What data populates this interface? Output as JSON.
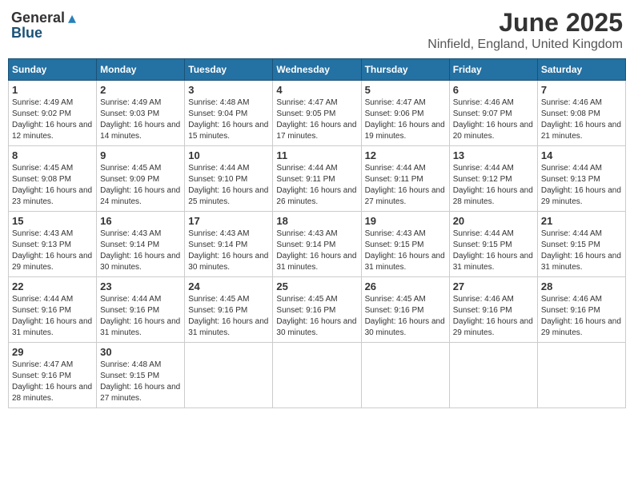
{
  "logo": {
    "general": "General",
    "blue": "Blue",
    "tagline": ""
  },
  "title": "June 2025",
  "location": "Ninfield, England, United Kingdom",
  "headers": [
    "Sunday",
    "Monday",
    "Tuesday",
    "Wednesday",
    "Thursday",
    "Friday",
    "Saturday"
  ],
  "weeks": [
    [
      {
        "day": "1",
        "sunrise": "Sunrise: 4:49 AM",
        "sunset": "Sunset: 9:02 PM",
        "daylight": "Daylight: 16 hours and 12 minutes."
      },
      {
        "day": "2",
        "sunrise": "Sunrise: 4:49 AM",
        "sunset": "Sunset: 9:03 PM",
        "daylight": "Daylight: 16 hours and 14 minutes."
      },
      {
        "day": "3",
        "sunrise": "Sunrise: 4:48 AM",
        "sunset": "Sunset: 9:04 PM",
        "daylight": "Daylight: 16 hours and 15 minutes."
      },
      {
        "day": "4",
        "sunrise": "Sunrise: 4:47 AM",
        "sunset": "Sunset: 9:05 PM",
        "daylight": "Daylight: 16 hours and 17 minutes."
      },
      {
        "day": "5",
        "sunrise": "Sunrise: 4:47 AM",
        "sunset": "Sunset: 9:06 PM",
        "daylight": "Daylight: 16 hours and 19 minutes."
      },
      {
        "day": "6",
        "sunrise": "Sunrise: 4:46 AM",
        "sunset": "Sunset: 9:07 PM",
        "daylight": "Daylight: 16 hours and 20 minutes."
      },
      {
        "day": "7",
        "sunrise": "Sunrise: 4:46 AM",
        "sunset": "Sunset: 9:08 PM",
        "daylight": "Daylight: 16 hours and 21 minutes."
      }
    ],
    [
      {
        "day": "8",
        "sunrise": "Sunrise: 4:45 AM",
        "sunset": "Sunset: 9:08 PM",
        "daylight": "Daylight: 16 hours and 23 minutes."
      },
      {
        "day": "9",
        "sunrise": "Sunrise: 4:45 AM",
        "sunset": "Sunset: 9:09 PM",
        "daylight": "Daylight: 16 hours and 24 minutes."
      },
      {
        "day": "10",
        "sunrise": "Sunrise: 4:44 AM",
        "sunset": "Sunset: 9:10 PM",
        "daylight": "Daylight: 16 hours and 25 minutes."
      },
      {
        "day": "11",
        "sunrise": "Sunrise: 4:44 AM",
        "sunset": "Sunset: 9:11 PM",
        "daylight": "Daylight: 16 hours and 26 minutes."
      },
      {
        "day": "12",
        "sunrise": "Sunrise: 4:44 AM",
        "sunset": "Sunset: 9:11 PM",
        "daylight": "Daylight: 16 hours and 27 minutes."
      },
      {
        "day": "13",
        "sunrise": "Sunrise: 4:44 AM",
        "sunset": "Sunset: 9:12 PM",
        "daylight": "Daylight: 16 hours and 28 minutes."
      },
      {
        "day": "14",
        "sunrise": "Sunrise: 4:44 AM",
        "sunset": "Sunset: 9:13 PM",
        "daylight": "Daylight: 16 hours and 29 minutes."
      }
    ],
    [
      {
        "day": "15",
        "sunrise": "Sunrise: 4:43 AM",
        "sunset": "Sunset: 9:13 PM",
        "daylight": "Daylight: 16 hours and 29 minutes."
      },
      {
        "day": "16",
        "sunrise": "Sunrise: 4:43 AM",
        "sunset": "Sunset: 9:14 PM",
        "daylight": "Daylight: 16 hours and 30 minutes."
      },
      {
        "day": "17",
        "sunrise": "Sunrise: 4:43 AM",
        "sunset": "Sunset: 9:14 PM",
        "daylight": "Daylight: 16 hours and 30 minutes."
      },
      {
        "day": "18",
        "sunrise": "Sunrise: 4:43 AM",
        "sunset": "Sunset: 9:14 PM",
        "daylight": "Daylight: 16 hours and 31 minutes."
      },
      {
        "day": "19",
        "sunrise": "Sunrise: 4:43 AM",
        "sunset": "Sunset: 9:15 PM",
        "daylight": "Daylight: 16 hours and 31 minutes."
      },
      {
        "day": "20",
        "sunrise": "Sunrise: 4:44 AM",
        "sunset": "Sunset: 9:15 PM",
        "daylight": "Daylight: 16 hours and 31 minutes."
      },
      {
        "day": "21",
        "sunrise": "Sunrise: 4:44 AM",
        "sunset": "Sunset: 9:15 PM",
        "daylight": "Daylight: 16 hours and 31 minutes."
      }
    ],
    [
      {
        "day": "22",
        "sunrise": "Sunrise: 4:44 AM",
        "sunset": "Sunset: 9:16 PM",
        "daylight": "Daylight: 16 hours and 31 minutes."
      },
      {
        "day": "23",
        "sunrise": "Sunrise: 4:44 AM",
        "sunset": "Sunset: 9:16 PM",
        "daylight": "Daylight: 16 hours and 31 minutes."
      },
      {
        "day": "24",
        "sunrise": "Sunrise: 4:45 AM",
        "sunset": "Sunset: 9:16 PM",
        "daylight": "Daylight: 16 hours and 31 minutes."
      },
      {
        "day": "25",
        "sunrise": "Sunrise: 4:45 AM",
        "sunset": "Sunset: 9:16 PM",
        "daylight": "Daylight: 16 hours and 30 minutes."
      },
      {
        "day": "26",
        "sunrise": "Sunrise: 4:45 AM",
        "sunset": "Sunset: 9:16 PM",
        "daylight": "Daylight: 16 hours and 30 minutes."
      },
      {
        "day": "27",
        "sunrise": "Sunrise: 4:46 AM",
        "sunset": "Sunset: 9:16 PM",
        "daylight": "Daylight: 16 hours and 29 minutes."
      },
      {
        "day": "28",
        "sunrise": "Sunrise: 4:46 AM",
        "sunset": "Sunset: 9:16 PM",
        "daylight": "Daylight: 16 hours and 29 minutes."
      }
    ],
    [
      {
        "day": "29",
        "sunrise": "Sunrise: 4:47 AM",
        "sunset": "Sunset: 9:16 PM",
        "daylight": "Daylight: 16 hours and 28 minutes."
      },
      {
        "day": "30",
        "sunrise": "Sunrise: 4:48 AM",
        "sunset": "Sunset: 9:15 PM",
        "daylight": "Daylight: 16 hours and 27 minutes."
      },
      null,
      null,
      null,
      null,
      null
    ]
  ]
}
